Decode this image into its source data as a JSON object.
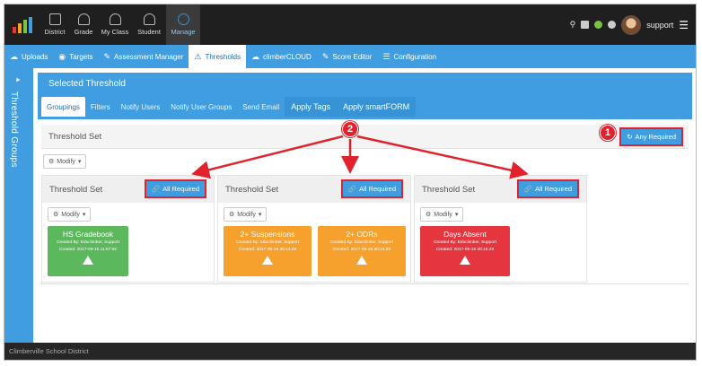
{
  "topnav": {
    "items": [
      {
        "label": "District",
        "icon": "building-icon"
      },
      {
        "label": "Grade",
        "icon": "users-icon"
      },
      {
        "label": "My Class",
        "icon": "users-icon"
      },
      {
        "label": "Student",
        "icon": "user-icon"
      },
      {
        "label": "Manage",
        "icon": "wrench-icon"
      }
    ],
    "user": "support"
  },
  "tabs": [
    {
      "label": "Uploads",
      "icon": "cloud-icon"
    },
    {
      "label": "Targets",
      "icon": "target-icon"
    },
    {
      "label": "Assessment Manager",
      "icon": "pencil-icon"
    },
    {
      "label": "Thresholds",
      "icon": "warning-icon"
    },
    {
      "label": "climberCLOUD",
      "icon": "cloud-icon"
    },
    {
      "label": "Score Editor",
      "icon": "pencil-icon"
    },
    {
      "label": "Configuration",
      "icon": "menu-icon"
    }
  ],
  "rail": {
    "label": "Threshold Groups"
  },
  "selected": {
    "title": "Selected Threshold",
    "subtabs": [
      "Groupings",
      "Filters",
      "Notify Users",
      "Notify User Groups",
      "Send Email",
      "Apply Tags",
      "Apply smartFORM"
    ]
  },
  "set": {
    "title": "Threshold Set",
    "any_required": "Any Required",
    "modify": "Modify"
  },
  "groups": [
    {
      "title": "Threshold Set",
      "all_required": "All Required",
      "modify": "Modify",
      "cards": [
        {
          "title": "HS Gradebook",
          "created_by": "Created By: Educlimber, Support",
          "created": "Created: 2017-09-15 11:57:02",
          "color": "#5cb85c"
        }
      ]
    },
    {
      "title": "Threshold Set",
      "all_required": "All Required",
      "modify": "Modify",
      "cards": [
        {
          "title": "2+ Suspensions",
          "created_by": "Created By: Educlimber, Support",
          "created": "Created: 2017-09-15 20:14:49",
          "color": "#f6a02d"
        },
        {
          "title": "2+ ODRs",
          "created_by": "Created By: Educlimber, Support",
          "created": "Created: 2017-09-15 20:14:20",
          "color": "#f6a02d"
        }
      ]
    },
    {
      "title": "Threshold Set",
      "all_required": "All Required",
      "modify": "Modify",
      "cards": [
        {
          "title": "Days Absent",
          "created_by": "Created By: Educlimber, Support",
          "created": "Created: 2017-09-15 20:15:29",
          "color": "#e5353f"
        }
      ]
    }
  ],
  "annotations": {
    "badge1": "1",
    "badge2": "2"
  },
  "footer": {
    "district": "Climberville School District"
  },
  "colors": {
    "accent": "#3f9de0",
    "annotation": "#e0222d",
    "nav": "#1f1f1f"
  }
}
